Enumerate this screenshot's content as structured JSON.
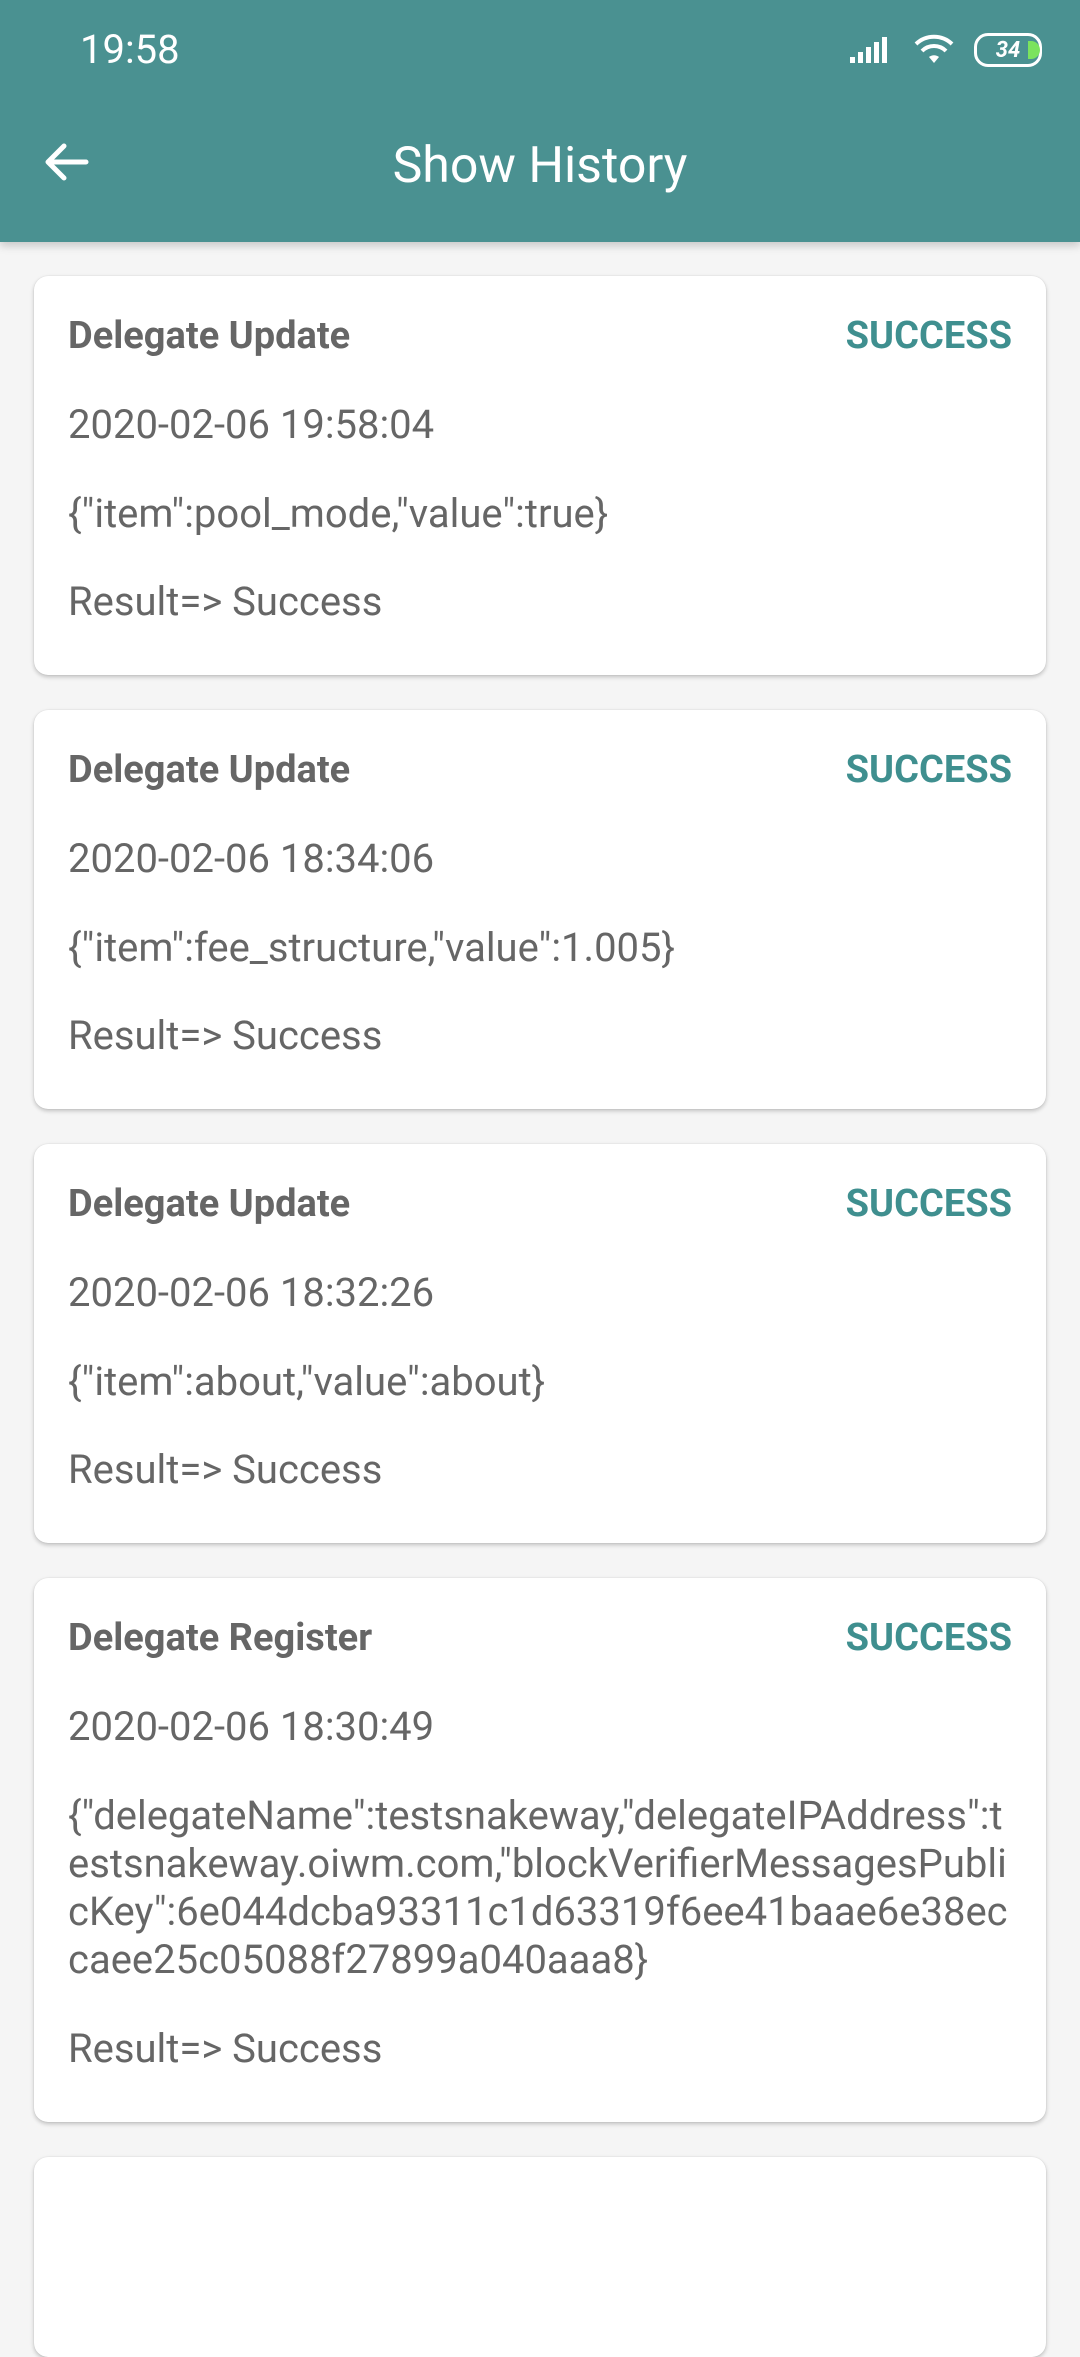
{
  "status_bar": {
    "time": "19:58",
    "battery": "34"
  },
  "header": {
    "title": "Show History"
  },
  "history": [
    {
      "type": "Delegate Update",
      "status": "SUCCESS",
      "timestamp": "2020-02-06 19:58:04",
      "payload": "{\"item\":pool_mode,\"value\":true}",
      "result": "Result=> Success"
    },
    {
      "type": "Delegate Update",
      "status": "SUCCESS",
      "timestamp": "2020-02-06 18:34:06",
      "payload": "{\"item\":fee_structure,\"value\":1.005}",
      "result": "Result=> Success"
    },
    {
      "type": "Delegate Update",
      "status": "SUCCESS",
      "timestamp": "2020-02-06 18:32:26",
      "payload": "{\"item\":about,\"value\":about}",
      "result": "Result=> Success"
    },
    {
      "type": "Delegate Register",
      "status": "SUCCESS",
      "timestamp": "2020-02-06 18:30:49",
      "payload": "{\"delegateName\":testsnakeway,\"delegateIPAddress\":testsnakeway.oiwm.com,\"blockVerifierMessagesPublicKey\":6e044dcba93311c1d63319f6ee41baae6e38eccaee25c05088f27899a040aaa8}",
      "result": "Result=> Success"
    }
  ],
  "colors": {
    "primary": "#4a9191",
    "status_success": "#3f8f8f",
    "text_secondary": "#666666",
    "background": "#f5f5f5"
  }
}
